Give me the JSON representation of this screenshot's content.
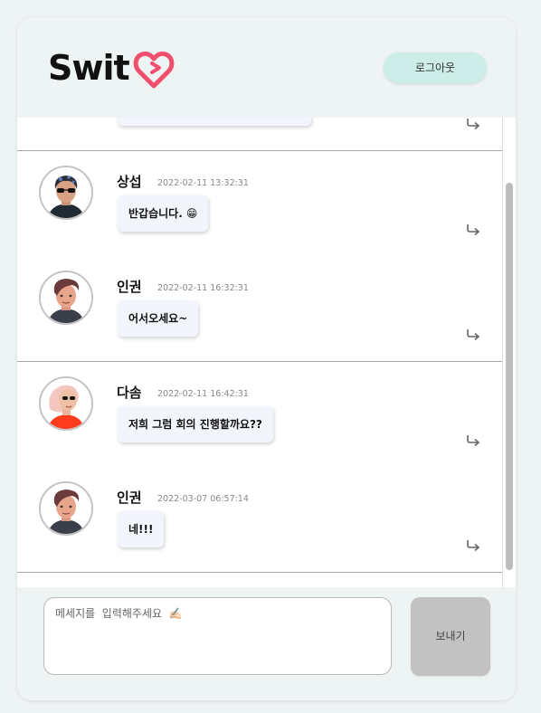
{
  "header": {
    "logo_text": "Swit",
    "logout_label": "로그아웃"
  },
  "messages": [
    {
      "name": "",
      "time": "",
      "text": ""
    },
    {
      "name": "상섭",
      "time": "2022-02-11 13:32:31",
      "text": "반갑습니다. 😁",
      "avatar": "avatar-sangseop"
    },
    {
      "name": "인권",
      "time": "2022-02-11 16:32:31",
      "text": "어서오세요~",
      "avatar": "avatar-ingwon"
    },
    {
      "name": "다솜",
      "time": "2022-02-11 16:42:31",
      "text": "저희 그럼 회의 진행할까요??",
      "avatar": "avatar-dasom"
    },
    {
      "name": "인권",
      "time": "2022-03-07 06:57:14",
      "text": "네!!!",
      "avatar": "avatar-ingwon"
    }
  ],
  "composer": {
    "placeholder": "메세지를  입력해주세요  ✍🏻",
    "send_label": "보내기"
  },
  "colors": {
    "background": "#eef3f3",
    "logout_button": "#cdeee8",
    "send_button": "#c2c2c2",
    "bubble": "#f2f5fb",
    "logo_heart": "#f0506e"
  }
}
